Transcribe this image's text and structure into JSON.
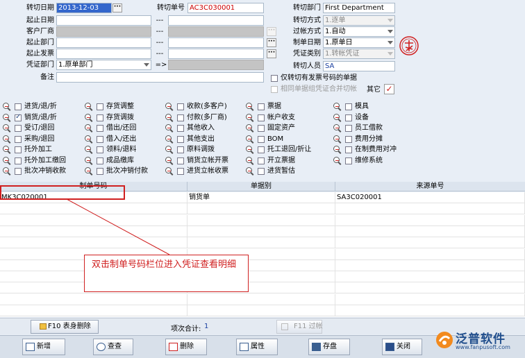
{
  "form": {
    "date_label": "转切日期",
    "date_value": "2013-12-03",
    "range_date_label": "起止日期",
    "customer_label": "客户厂商",
    "dept_label": "起止部门",
    "invoice_label": "起止发票",
    "voucher_dept_label": "凭证部门",
    "voucher_dept_value": "1.原单部门",
    "arrow": "=>",
    "remark_label": "备注",
    "range_sep": "---",
    "order_no_label": "转切单号",
    "order_no_value": "AC3C030001",
    "transfer_dept_label": "转切部门",
    "transfer_dept_value": "First Department",
    "transfer_mode_label": "转切方式",
    "transfer_mode_value": "1.逐单",
    "posting_mode_label": "过帐方式",
    "posting_mode_value": "1.自动",
    "make_date_label": "制单日期",
    "make_date_value": "1.原单日",
    "voucher_type_label": "凭证类别",
    "voucher_type_value": "1.转帐凭证",
    "operator_label": "转切人员",
    "operator_value": "SA",
    "opt_invoice_only": "仅转切有发票号码的单据",
    "opt_merge": "相同单据组凭证合并切帐",
    "other_label": "其它",
    "ellipsis": "···"
  },
  "checkgroups": [
    {
      "items": [
        {
          "label": "进货/退/折",
          "checked": false
        },
        {
          "label": "销货/退/折",
          "checked": true
        },
        {
          "label": "受订/退回",
          "checked": false
        },
        {
          "label": "采购/退回",
          "checked": false
        },
        {
          "label": "托外加工",
          "checked": false
        },
        {
          "label": "托外加工缴回",
          "checked": false
        },
        {
          "label": "批次冲销收款",
          "checked": false
        }
      ]
    },
    {
      "items": [
        {
          "label": "存货调整",
          "checked": false
        },
        {
          "label": "存货调拨",
          "checked": false
        },
        {
          "label": "借出/还回",
          "checked": false
        },
        {
          "label": "借入/还出",
          "checked": false
        },
        {
          "label": "领料/退料",
          "checked": false
        },
        {
          "label": "成品缴库",
          "checked": false
        },
        {
          "label": "批次冲销付款",
          "checked": false
        }
      ]
    },
    {
      "items": [
        {
          "label": "收款(多客户)",
          "checked": false
        },
        {
          "label": "付款(多厂商)",
          "checked": false
        },
        {
          "label": "其他收入",
          "checked": false
        },
        {
          "label": "其他支出",
          "checked": false
        },
        {
          "label": "原料调拨",
          "checked": false
        },
        {
          "label": "销货立帐开票",
          "checked": false
        },
        {
          "label": "进货立帐收票",
          "checked": false
        }
      ]
    },
    {
      "items": [
        {
          "label": "票据",
          "checked": false
        },
        {
          "label": "帐户收支",
          "checked": false
        },
        {
          "label": "固定资产",
          "checked": false
        },
        {
          "label": "BOM",
          "checked": false
        },
        {
          "label": "托工退回/折让",
          "checked": false
        },
        {
          "label": "开立票据",
          "checked": false
        },
        {
          "label": "进货暂估",
          "checked": false
        }
      ]
    },
    {
      "items": [
        {
          "label": "模具",
          "checked": false
        },
        {
          "label": "设备",
          "checked": false
        },
        {
          "label": "员工借款",
          "checked": false
        },
        {
          "label": "费用分摊",
          "checked": false
        },
        {
          "label": "在制费用对冲",
          "checked": false
        },
        {
          "label": "维修系统",
          "checked": false
        }
      ]
    }
  ],
  "grid": {
    "columns": [
      "制单号码",
      "单据别",
      "来源单号"
    ],
    "rows": [
      [
        "MK3C020001",
        "销货单",
        "SA3C020001"
      ]
    ]
  },
  "status": {
    "delete_btn": "F10 表身删除",
    "total_label": "项次合计:",
    "total_value": "1",
    "f11_btn": "F11 过帐"
  },
  "toolbar": {
    "new": "新增",
    "query": "查查",
    "delete": "删除",
    "props": "属性",
    "save": "存盘",
    "close": "关闭"
  },
  "callout": "双击制单号码栏位进入凭证查看明细",
  "brand": {
    "name": "泛普软件",
    "url": "www.fanpusoft.com"
  }
}
